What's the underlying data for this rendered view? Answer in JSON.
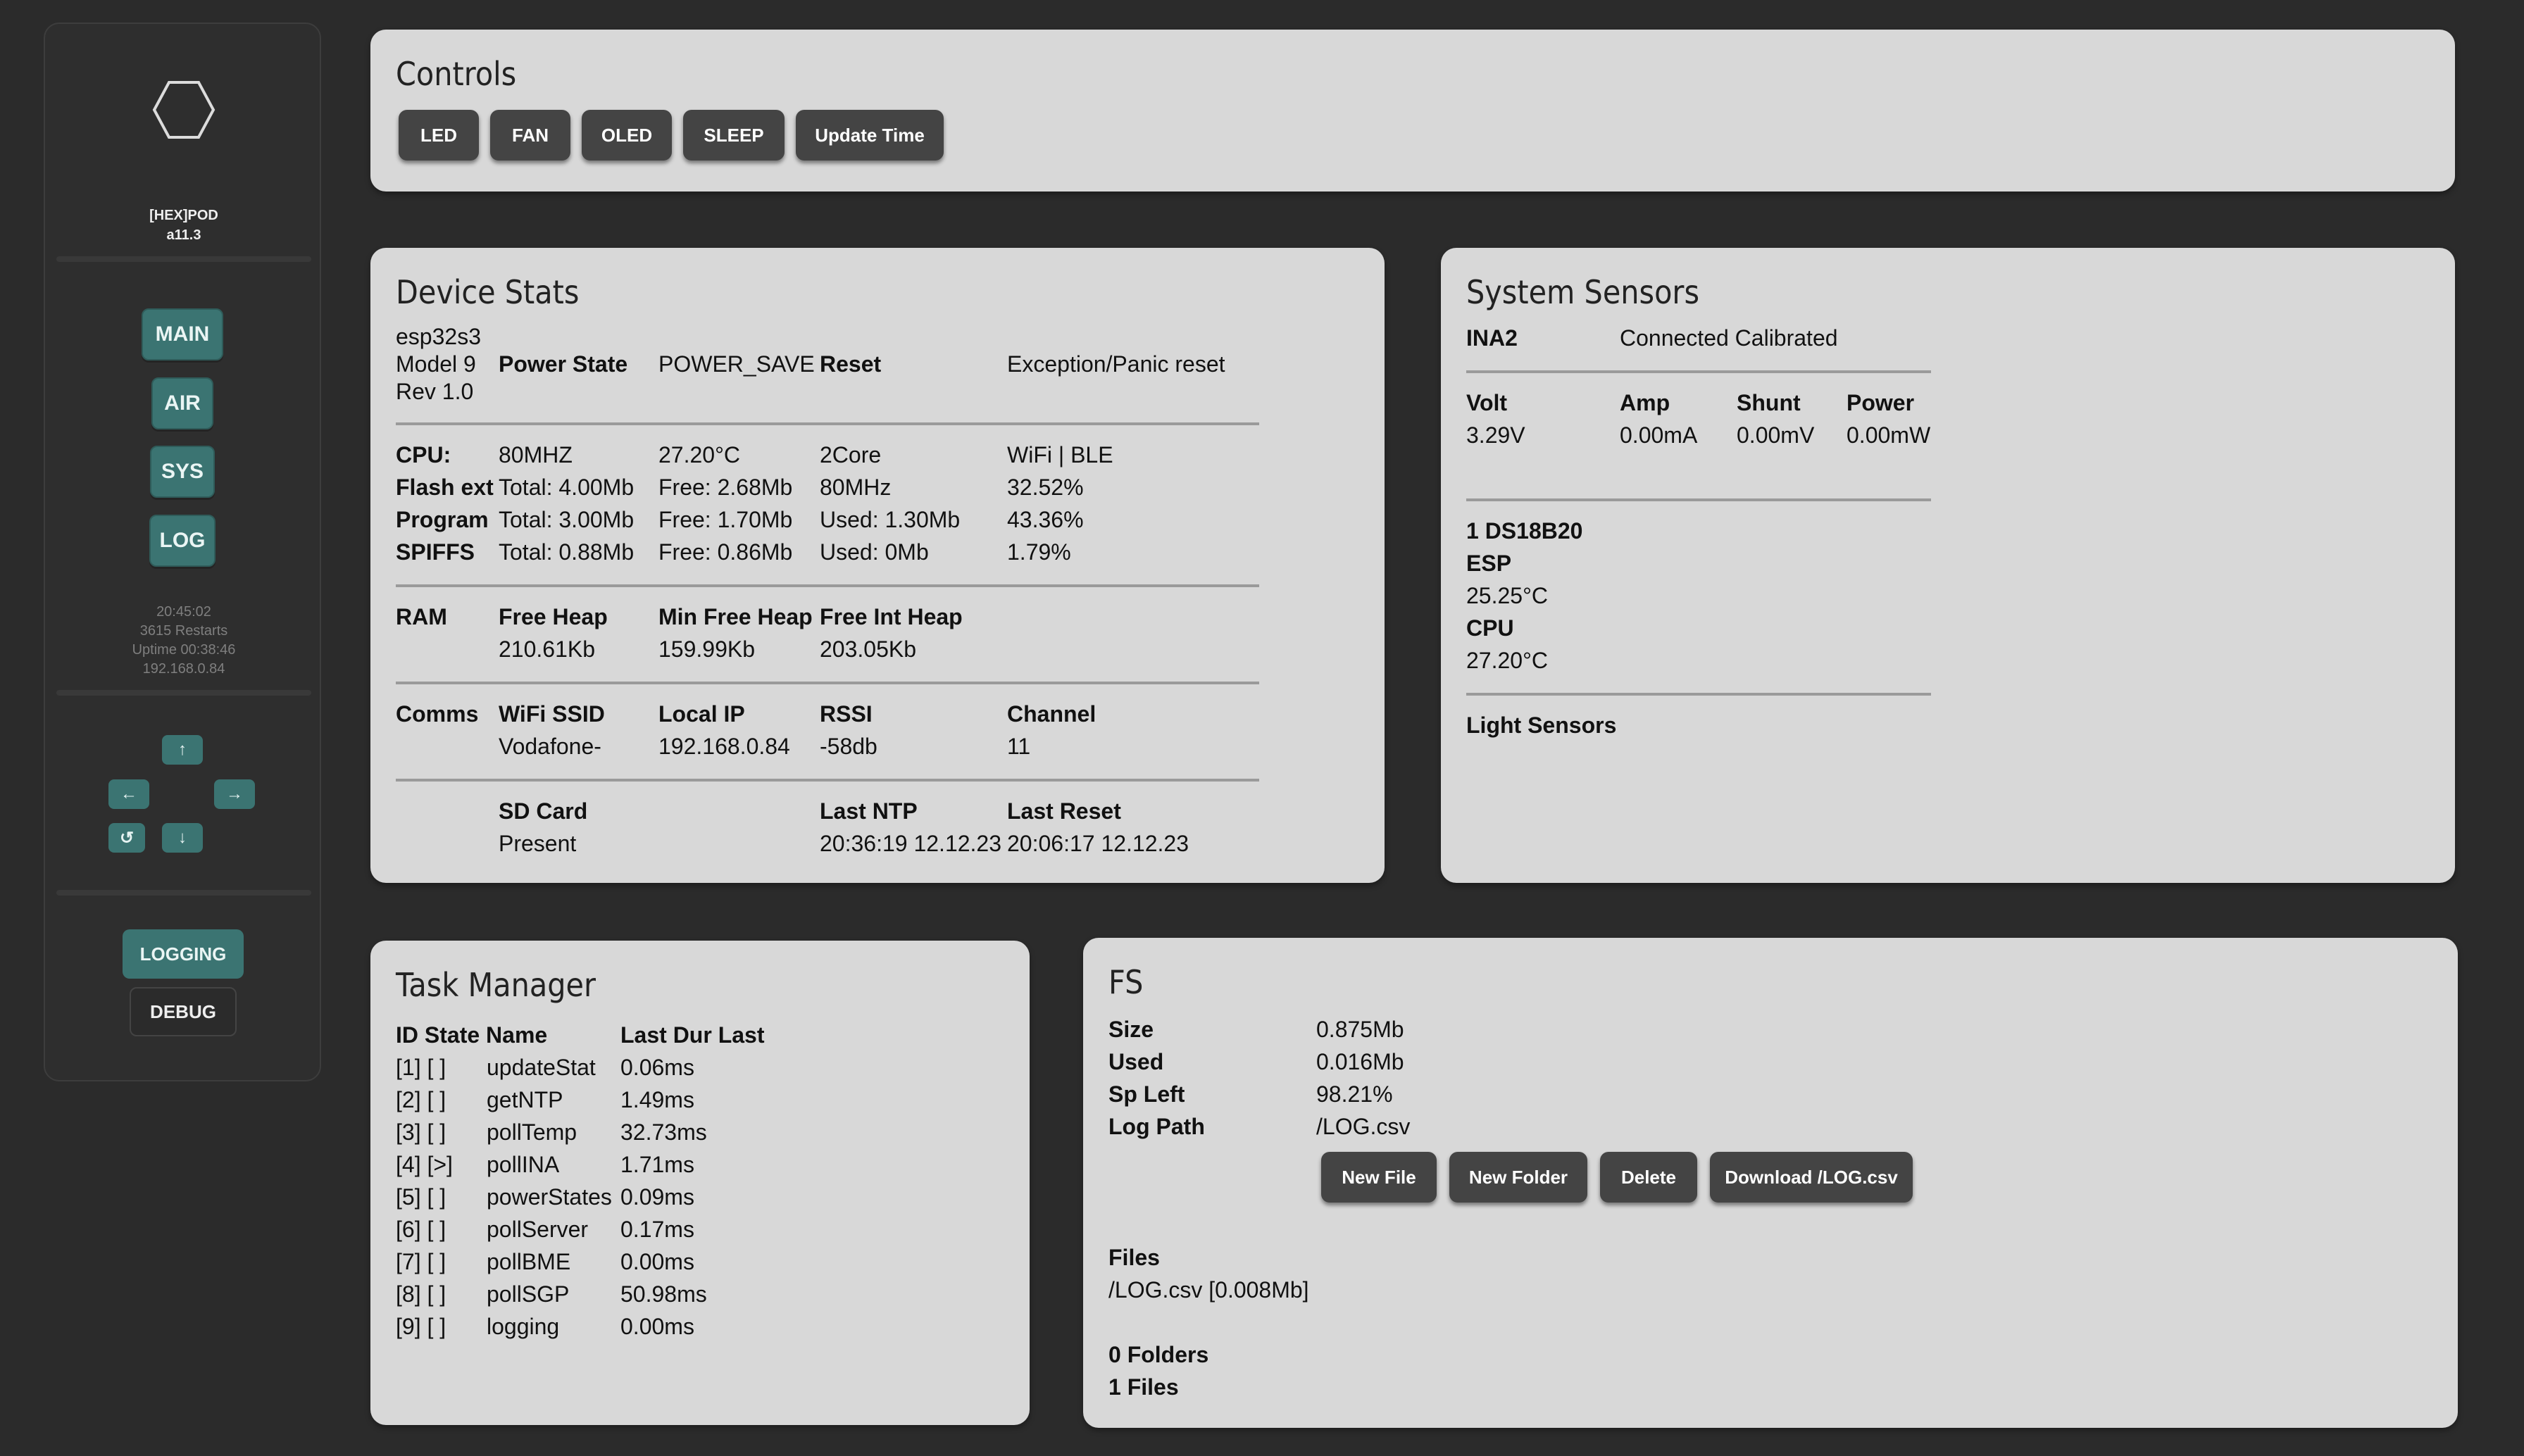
{
  "sidebar": {
    "brand": "[HEX]POD",
    "version": "a11.3",
    "nav": [
      "MAIN",
      "AIR",
      "SYS",
      "LOG"
    ],
    "time": "20:45:02",
    "restarts": "3615 Restarts",
    "uptime": "Uptime 00:38:46",
    "ip": "192.168.0.84",
    "arrows": {
      "up": "↑",
      "left": "←",
      "right": "→",
      "reset": "↺",
      "down": "↓"
    },
    "modes": {
      "logging": "LOGGING",
      "debug": "DEBUG"
    }
  },
  "controls": {
    "title": "Controls",
    "buttons": [
      "LED",
      "FAN",
      "OLED",
      "SLEEP",
      "Update Time"
    ]
  },
  "device": {
    "title": "Device Stats",
    "chip": "esp32s3",
    "model": "Model 9",
    "rev": "Rev 1.0",
    "power_label": "Power State",
    "power_value": "POWER_SAVE",
    "reset_label": "Reset",
    "reset_value": "Exception/Panic reset",
    "cpu": {
      "label": "CPU:",
      "freq": "80MHZ",
      "temp": "27.20°C",
      "cores": "2Core",
      "radio": "WiFi | BLE"
    },
    "flash": {
      "label": "Flash ext",
      "total": "Total: 4.00Mb",
      "free": "Free: 2.68Mb",
      "speed": "80MHz",
      "pct": "32.52%"
    },
    "program": {
      "label": "Program",
      "total": "Total: 3.00Mb",
      "free": "Free: 1.70Mb",
      "used": "Used: 1.30Mb",
      "pct": "43.36%"
    },
    "spiffs": {
      "label": "SPIFFS",
      "total": "Total: 0.88Mb",
      "free": "Free: 0.86Mb",
      "used": "Used: 0Mb",
      "pct": "1.79%"
    },
    "ram": {
      "label": "RAM",
      "h1": "Free Heap",
      "h2": "Min Free Heap",
      "h3": "Free Int Heap",
      "v1": "210.61Kb",
      "v2": "159.99Kb",
      "v3": "203.05Kb"
    },
    "comms": {
      "label": "Comms",
      "h1": "WiFi SSID",
      "h2": "Local IP",
      "h3": "RSSI",
      "h4": "Channel",
      "v1": "Vodafone-",
      "v2": "192.168.0.84",
      "v3": "-58db",
      "v4": "11"
    },
    "misc": {
      "h1": "SD Card",
      "h2": "Last NTP",
      "h3": "Last Reset",
      "v1": "Present",
      "v2": "20:36:19 12.12.23",
      "v3": "20:06:17 12.12.23"
    }
  },
  "sensors": {
    "title": "System Sensors",
    "ina_label": "INA2",
    "ina_status": "Connected Calibrated",
    "headers": [
      "Volt",
      "Amp",
      "Shunt",
      "Power"
    ],
    "values": [
      "3.29V",
      "0.00mA",
      "0.00mV",
      "0.00mW"
    ],
    "ds_label": "1 DS18B20",
    "esp_label": "ESP",
    "esp_temp": "25.25°C",
    "cpu_label": "CPU",
    "cpu_temp": "27.20°C",
    "light_label": "Light Sensors"
  },
  "tasks": {
    "title": "Task Manager",
    "header": "ID State Name",
    "header2": "Last Dur Last",
    "rows": [
      {
        "id": "[1] [ ]",
        "name": "updateStat",
        "dur": "0.06ms"
      },
      {
        "id": "[2] [ ]",
        "name": "getNTP",
        "dur": "1.49ms"
      },
      {
        "id": "[3] [ ]",
        "name": "pollTemp",
        "dur": "32.73ms"
      },
      {
        "id": "[4] [>]",
        "name": "pollINA",
        "dur": "1.71ms"
      },
      {
        "id": "[5] [ ]",
        "name": "powerStates",
        "dur": "0.09ms"
      },
      {
        "id": "[6] [ ]",
        "name": "pollServer",
        "dur": "0.17ms"
      },
      {
        "id": "[7] [ ]",
        "name": "pollBME",
        "dur": "0.00ms"
      },
      {
        "id": "[8] [ ]",
        "name": "pollSGP",
        "dur": "50.98ms"
      },
      {
        "id": "[9] [ ]",
        "name": "logging",
        "dur": "0.00ms"
      }
    ]
  },
  "fs": {
    "title": "FS",
    "size_label": "Size",
    "size": "0.875Mb",
    "used_label": "Used",
    "used": "0.016Mb",
    "left_label": "Sp Left",
    "left": "98.21%",
    "path_label": "Log Path",
    "path": "/LOG.csv",
    "buttons": [
      "New File",
      "New Folder",
      "Delete",
      "Download /LOG.csv"
    ],
    "files_label": "Files",
    "file": "/LOG.csv [0.008Mb]",
    "folders_count": "0 Folders",
    "files_count": "1 Files"
  }
}
